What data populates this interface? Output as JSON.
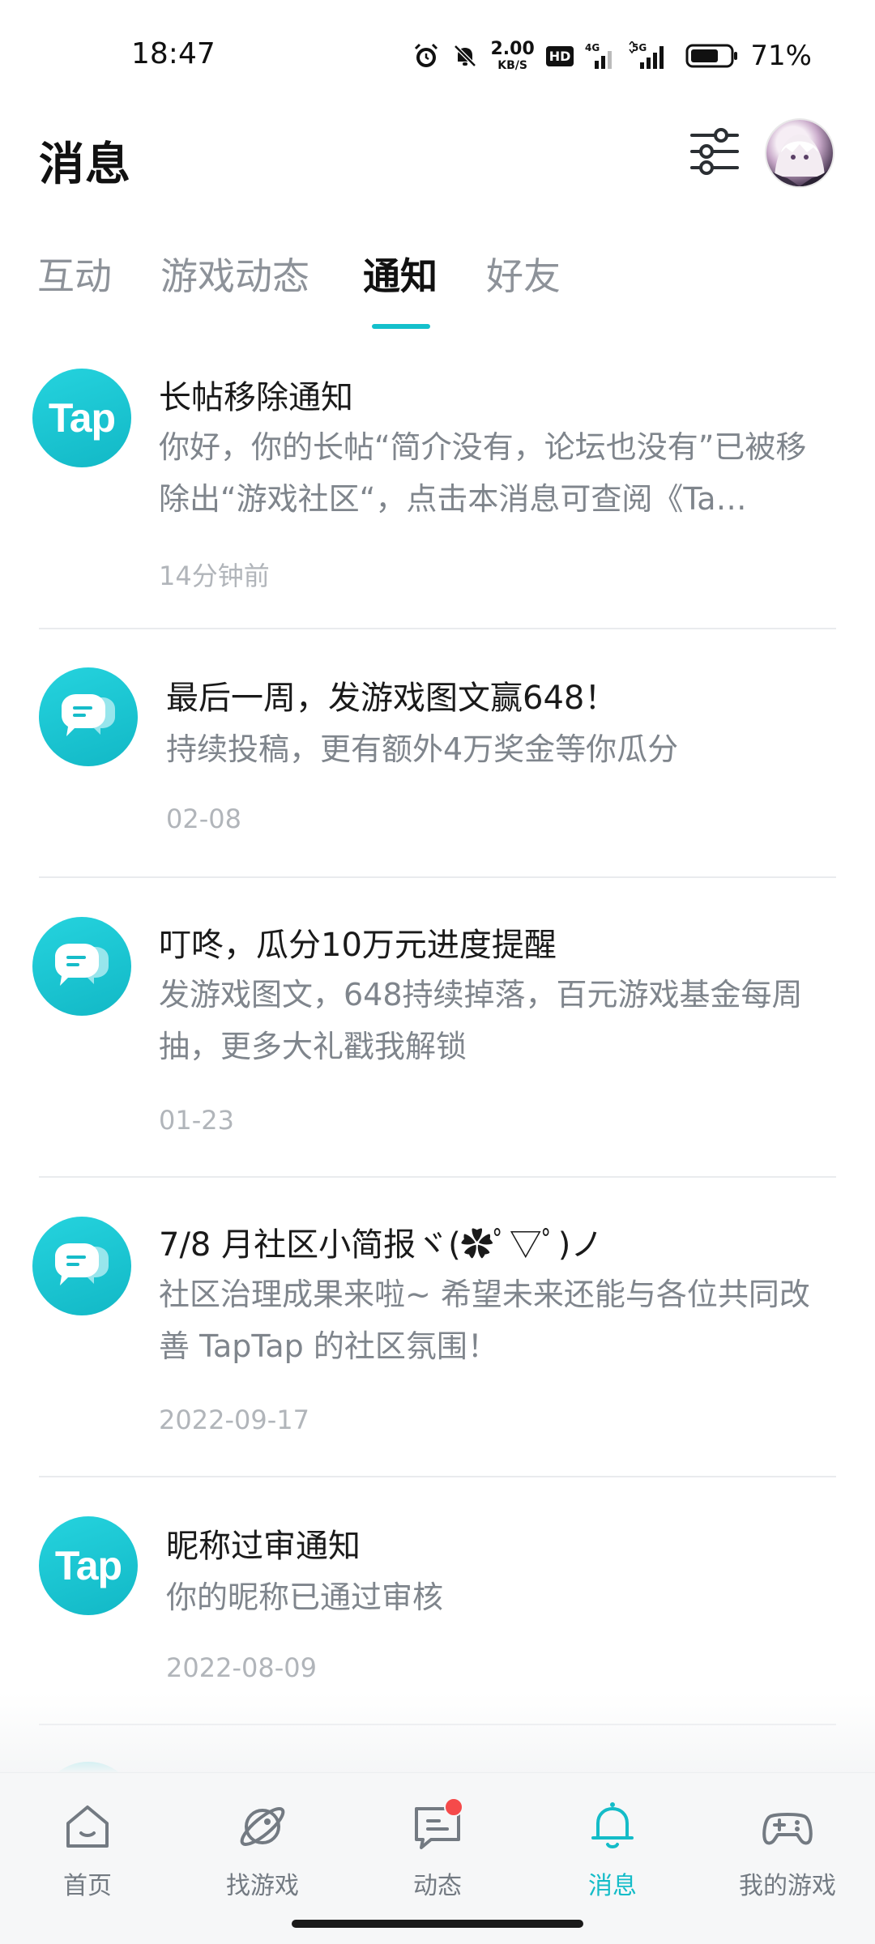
{
  "status_bar": {
    "time": "18:47",
    "net_speed_value": "2.00",
    "net_speed_unit": "KB/S",
    "hd_label": "HD",
    "signal_4g": "4G",
    "signal_5g": "5G",
    "battery_percent": "71%",
    "battery_level": 0.71
  },
  "header": {
    "title": "消息",
    "filter_icon": "sliders-icon",
    "avatar_icon": "user-avatar"
  },
  "tabs": [
    {
      "label": "互动",
      "active": false
    },
    {
      "label": "游戏动态",
      "active": false
    },
    {
      "label": "通知",
      "active": true
    },
    {
      "label": "好友",
      "active": false
    }
  ],
  "notifications": [
    {
      "icon": "tap-logo",
      "icon_text": "Tap",
      "title": "长帖移除通知",
      "body": "你好，你的长帖“简介没有，论坛也没有”已被移除出“游戏社区“，点击本消息可查阅《Ta…",
      "time": "14分钟前"
    },
    {
      "icon": "chat-bubble-icon",
      "title": "最后一周，发游戏图文赢648！",
      "body": "持续投稿，更有额外4万奖金等你瓜分",
      "time": "02-08"
    },
    {
      "icon": "chat-bubble-icon",
      "title": "叮咚，瓜分10万元进度提醒",
      "body": "发游戏图文，648持续掉落，百元游戏基金每周抽，更多大礼戳我解锁",
      "time": "01-23"
    },
    {
      "icon": "chat-bubble-icon",
      "title": "7/8 月社区小简报ヾ(✿ﾟ▽ﾟ)ノ",
      "body": "社区治理成果来啦~ 希望未来还能与各位共同改善 TapTap 的社区氛围！",
      "time": "2022-09-17"
    },
    {
      "icon": "tap-logo",
      "icon_text": "Tap",
      "title": "昵称过审通知",
      "body": "你的昵称已通过审核",
      "time": "2022-08-09"
    }
  ],
  "bottom_nav": [
    {
      "label": "首页",
      "icon": "home-icon",
      "active": false
    },
    {
      "label": "找游戏",
      "icon": "planet-icon",
      "active": false
    },
    {
      "label": "动态",
      "icon": "chat-icon",
      "active": false,
      "badge": true
    },
    {
      "label": "消息",
      "icon": "bell-icon",
      "active": true
    },
    {
      "label": "我的游戏",
      "icon": "gamepad-icon",
      "active": false
    }
  ],
  "colors": {
    "accent": "#14C0CC",
    "badge": "#F54A4A",
    "muted_text": "#7F858C",
    "time_text": "#B1B5BA"
  }
}
